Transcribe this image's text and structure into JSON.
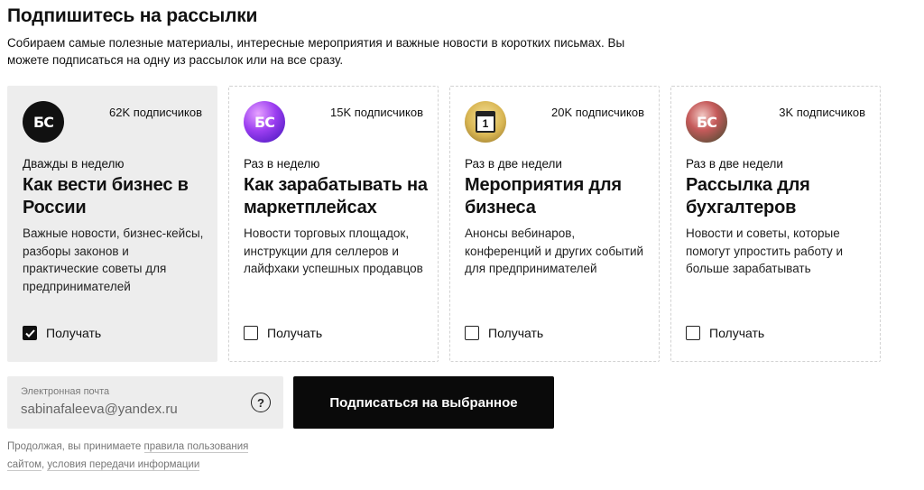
{
  "header": {
    "title": "Подпишитесь на рассылки",
    "subtitle": "Собираем самые полезные материалы, интересные мероприятия и важные новости в коротких письмах. Вы можете подписаться на одну из рассылок или на все сразу."
  },
  "cards": [
    {
      "logo_text": "БС",
      "logo_icon": "bs-logo-black",
      "subscribers": "62K подписчиков",
      "frequency": "Дважды в неделю",
      "name": "Как вести бизнес в России",
      "description": "Важные новости, бизнес-кейсы, разборы законов и практические советы для предпринимателей",
      "checkbox_label": "Получать",
      "checked": true
    },
    {
      "logo_text": "БС",
      "logo_icon": "bs-logo-purple",
      "subscribers": "15K подписчиков",
      "frequency": "Раз в неделю",
      "name": "Как зарабатывать на маркетплейсах",
      "description": "Новости торговых площадок, инструкции для селлеров и лайфхаки успешных продавцов",
      "checkbox_label": "Получать",
      "checked": false
    },
    {
      "logo_text": "1",
      "logo_icon": "calendar-icon",
      "subscribers": "20K подписчиков",
      "frequency": "Раз в две недели",
      "name": "Мероприятия для бизнеса",
      "description": "Анонсы вебинаров, конференций и других событий для предпринимателей",
      "checkbox_label": "Получать",
      "checked": false
    },
    {
      "logo_text": "БС",
      "logo_icon": "bs-logo-red",
      "subscribers": "3K подписчиков",
      "frequency": "Раз в две недели",
      "name": "Рассылка для бухгалтеров",
      "description": "Новости и советы, которые помогут упростить работу и больше зарабатывать",
      "checkbox_label": "Получать",
      "checked": false
    }
  ],
  "form": {
    "email_label": "Электронная почта",
    "email_value": "sabinafaleeva@yandex.ru",
    "help_symbol": "?",
    "submit_label": "Подписаться на выбранное"
  },
  "legal": {
    "prefix": "Продолжая, вы принимаете ",
    "terms_link": "правила пользования сайтом",
    "separator": ", ",
    "data_link": "условия передачи информации"
  },
  "colors": {
    "selected_card_bg": "#ededed",
    "button_bg": "#0a0a0a",
    "button_text": "#ffffff"
  }
}
